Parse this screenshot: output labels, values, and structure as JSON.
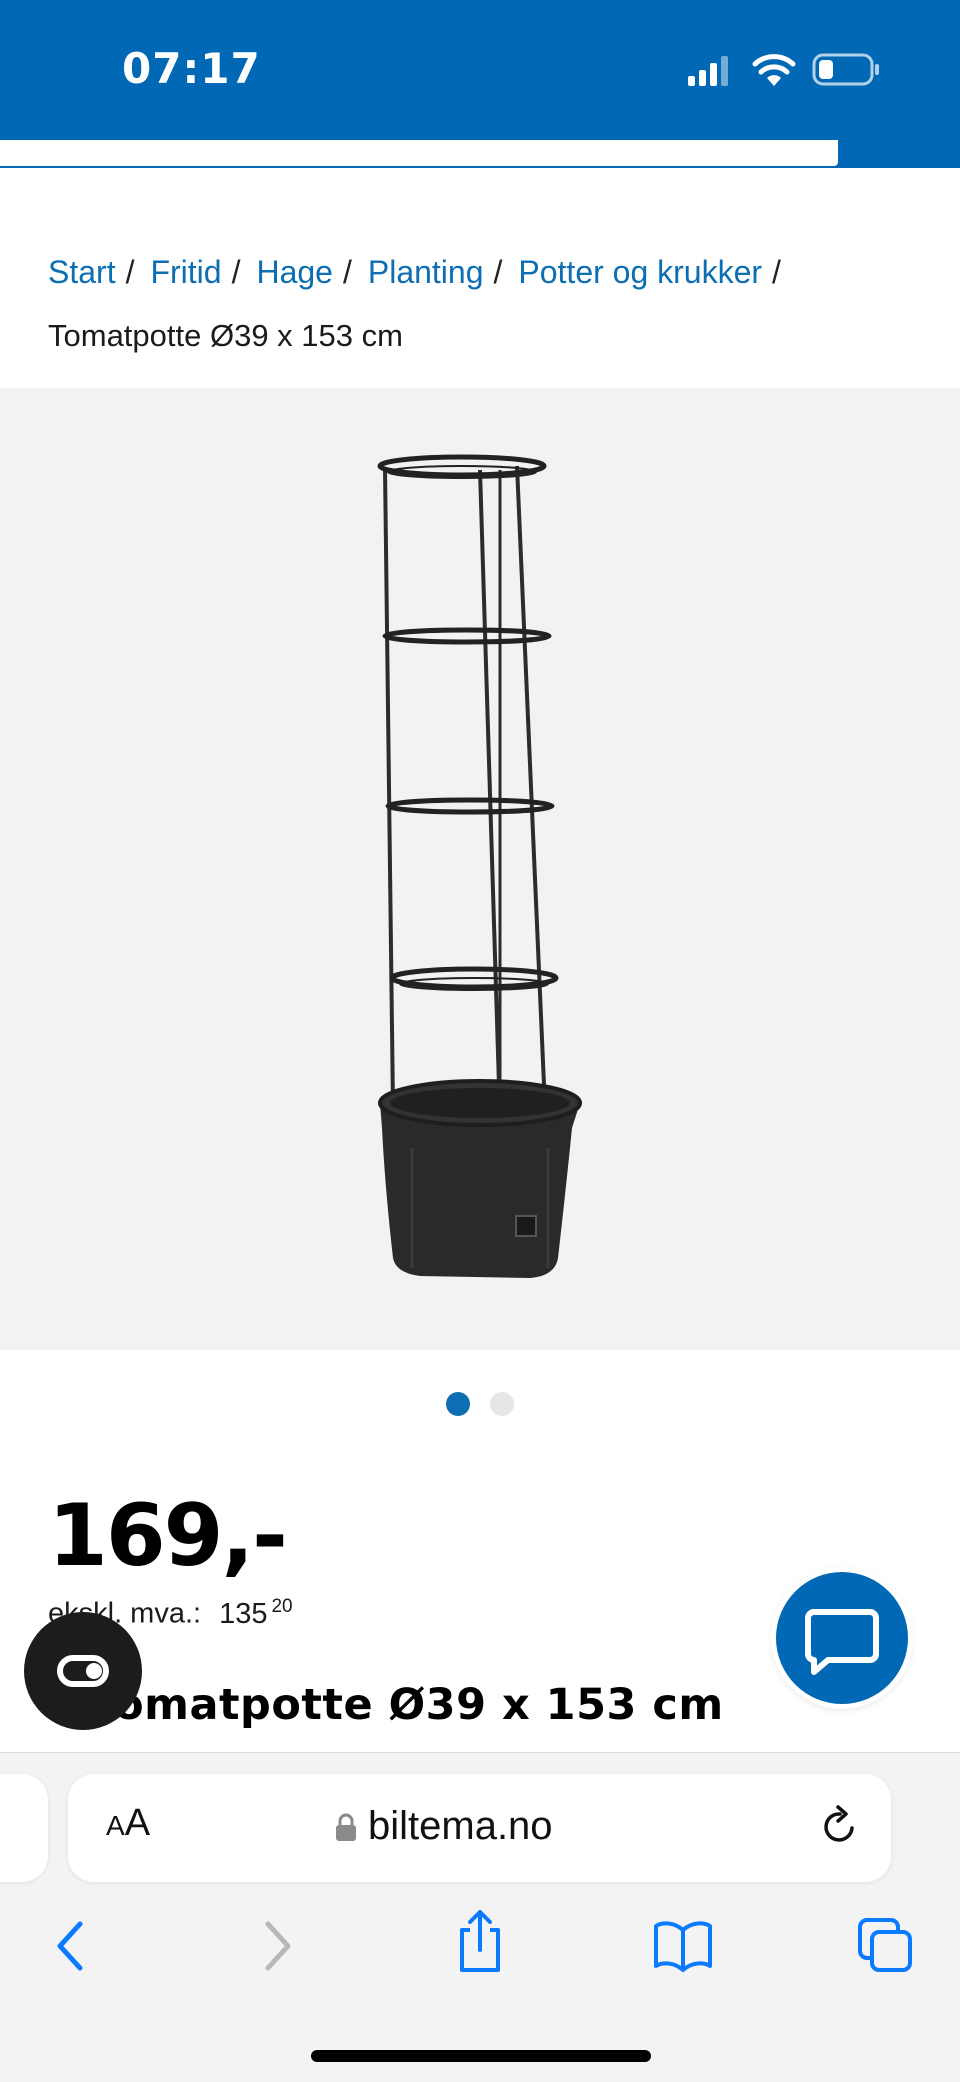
{
  "status_bar": {
    "time": "07:17"
  },
  "breadcrumb": {
    "links": [
      "Start",
      "Fritid",
      "Hage",
      "Planting",
      "Potter og krukker"
    ],
    "separator": "/",
    "current": "Tomatpotte Ø39 x 153 cm"
  },
  "gallery": {
    "slide_count": 2,
    "active_slide": 1
  },
  "product": {
    "price": "169,-",
    "ex_vat_label": "ekskl. mva.:",
    "ex_vat_main": "135",
    "ex_vat_cents": "20",
    "title": "Tomatpotte Ø39 x 153 cm"
  },
  "browser": {
    "text_size_label_small": "A",
    "text_size_label_large": "A",
    "url": "biltema.no"
  },
  "icons": {
    "cookie": "cookie-settings-icon",
    "chat": "chat-bubble-icon",
    "back": "chevron-left-icon",
    "forward": "chevron-right-icon",
    "share": "share-icon",
    "bookmarks": "book-icon",
    "tabs": "tabs-icon"
  },
  "colors": {
    "brand": "#0068b4",
    "link": "#0d6eb3"
  }
}
